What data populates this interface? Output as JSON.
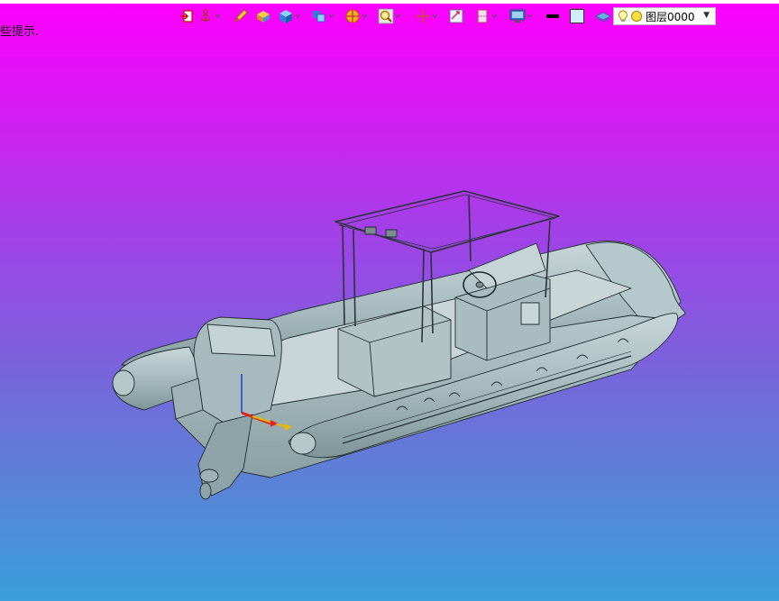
{
  "app": {
    "hint_text": "些提示."
  },
  "toolbar": {
    "items": [
      {
        "icon": "exit-sketch-icon",
        "dropdown": false
      },
      {
        "icon": "anchor-icon",
        "dropdown": true
      },
      {
        "icon": "pencil-icon",
        "dropdown": false
      },
      {
        "icon": "shaded-box-icon",
        "dropdown": false
      },
      {
        "icon": "blue-cube-icon",
        "dropdown": true
      },
      {
        "icon": "view-orientation-icon",
        "dropdown": true
      },
      {
        "icon": "render-style-icon",
        "dropdown": true
      },
      {
        "icon": "zoom-icon",
        "dropdown": true
      },
      {
        "icon": "pan-icon",
        "dropdown": true
      },
      {
        "icon": "fit-all-icon",
        "dropdown": false
      },
      {
        "icon": "section-view-icon",
        "dropdown": true
      },
      {
        "icon": "display-settings-icon",
        "dropdown": true
      },
      {
        "icon": "line-weight-icon",
        "dropdown": false
      },
      {
        "icon": "fill-color-icon",
        "dropdown": false
      },
      {
        "icon": "layer-filter-icon",
        "dropdown": true
      }
    ],
    "layer": {
      "name": "图层0000",
      "bulb_icon": "lightbulb-icon",
      "status_icon": "layer-status-icon"
    }
  },
  "model": {
    "description_icon": "rib-boat-model",
    "hull_color": "#a4b8bc",
    "line_color": "#1e2a2e"
  },
  "colors": {
    "bg_top": "#ff00ff",
    "bg_bottom": "#3a9fdb",
    "accent_red": "#e0241c",
    "accent_yellow": "#e8b800"
  }
}
